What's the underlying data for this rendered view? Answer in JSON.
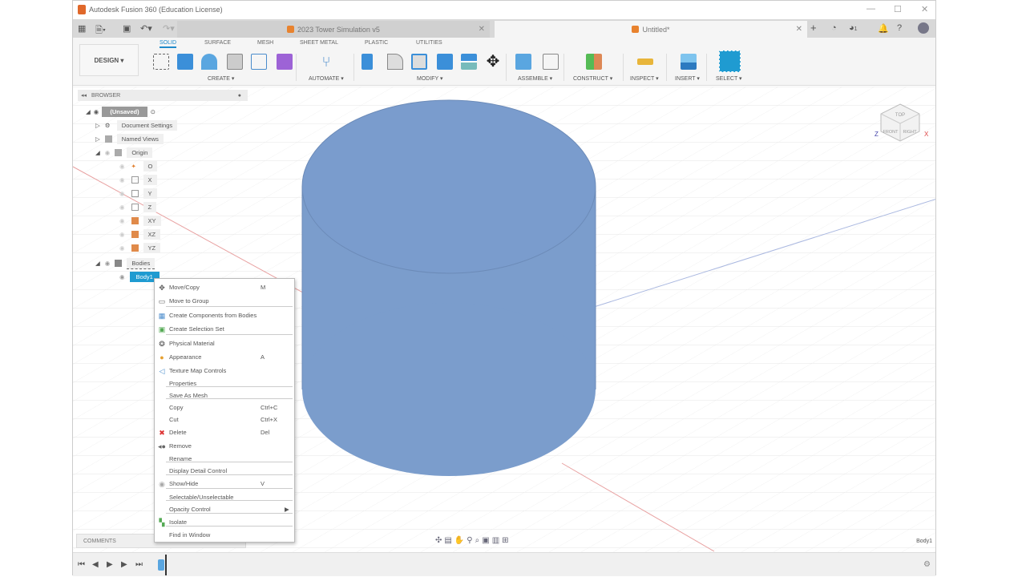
{
  "window": {
    "title": "Autodesk Fusion 360 (Education License)",
    "min": "—",
    "max": "☐",
    "close": "✕"
  },
  "tabs": [
    {
      "label": "2023 Tower Simulation v5",
      "close": "✕"
    },
    {
      "label": "Untitled*",
      "close": "✕"
    }
  ],
  "header_right": {
    "add": "+",
    "jobs_count": "1"
  },
  "ribbon": {
    "workspace": "DESIGN ▾",
    "tabs": [
      "SOLID",
      "SURFACE",
      "MESH",
      "SHEET METAL",
      "PLASTIC",
      "UTILITIES"
    ],
    "groups": [
      "CREATE ▾",
      "AUTOMATE ▾",
      "MODIFY ▾",
      "ASSEMBLE ▾",
      "CONSTRUCT ▾",
      "INSPECT ▾",
      "INSERT ▾",
      "SELECT ▾"
    ]
  },
  "browser": {
    "title": "BROWSER",
    "root": "(Unsaved)",
    "items": [
      "Document Settings",
      "Named Views",
      "Origin",
      "O",
      "X",
      "Y",
      "Z",
      "XY",
      "XZ",
      "YZ",
      "Bodies",
      "Body1"
    ]
  },
  "context_menu": [
    {
      "label": "Move/Copy",
      "shortcut": "M",
      "icon": "move-icon"
    },
    {
      "label": "Move to Group",
      "icon": "group-icon"
    },
    {
      "label": "Create Components from Bodies",
      "icon": "components-icon"
    },
    {
      "label": "Create Selection Set",
      "icon": "selection-set-icon"
    },
    {
      "label": "Physical Material",
      "icon": "material-icon"
    },
    {
      "label": "Appearance",
      "shortcut": "A",
      "icon": "appearance-icon"
    },
    {
      "label": "Texture Map Controls",
      "icon": "texture-icon"
    },
    {
      "label": "Properties"
    },
    {
      "label": "Save As Mesh"
    },
    {
      "label": "Copy",
      "shortcut": "Ctrl+C"
    },
    {
      "label": "Cut",
      "shortcut": "Ctrl+X"
    },
    {
      "label": "Delete",
      "shortcut": "Del",
      "icon": "delete-icon"
    },
    {
      "label": "Remove",
      "icon": "remove-icon"
    },
    {
      "label": "Rename"
    },
    {
      "label": "Display Detail Control"
    },
    {
      "label": "Show/Hide",
      "shortcut": "V",
      "icon": "eye-icon"
    },
    {
      "label": "Selectable/Unselectable"
    },
    {
      "label": "Opacity Control",
      "submenu": "▶"
    },
    {
      "label": "Isolate",
      "icon": "isolate-icon"
    },
    {
      "label": "Find in Window"
    }
  ],
  "comments": "COMMENTS",
  "status": {
    "selected": "Body1"
  },
  "viewcube": {
    "top": "TOP",
    "front": "FRONT",
    "right": "RIGHT"
  },
  "colors": {
    "accent": "#1f8acb",
    "body": "#7b9dcc"
  }
}
